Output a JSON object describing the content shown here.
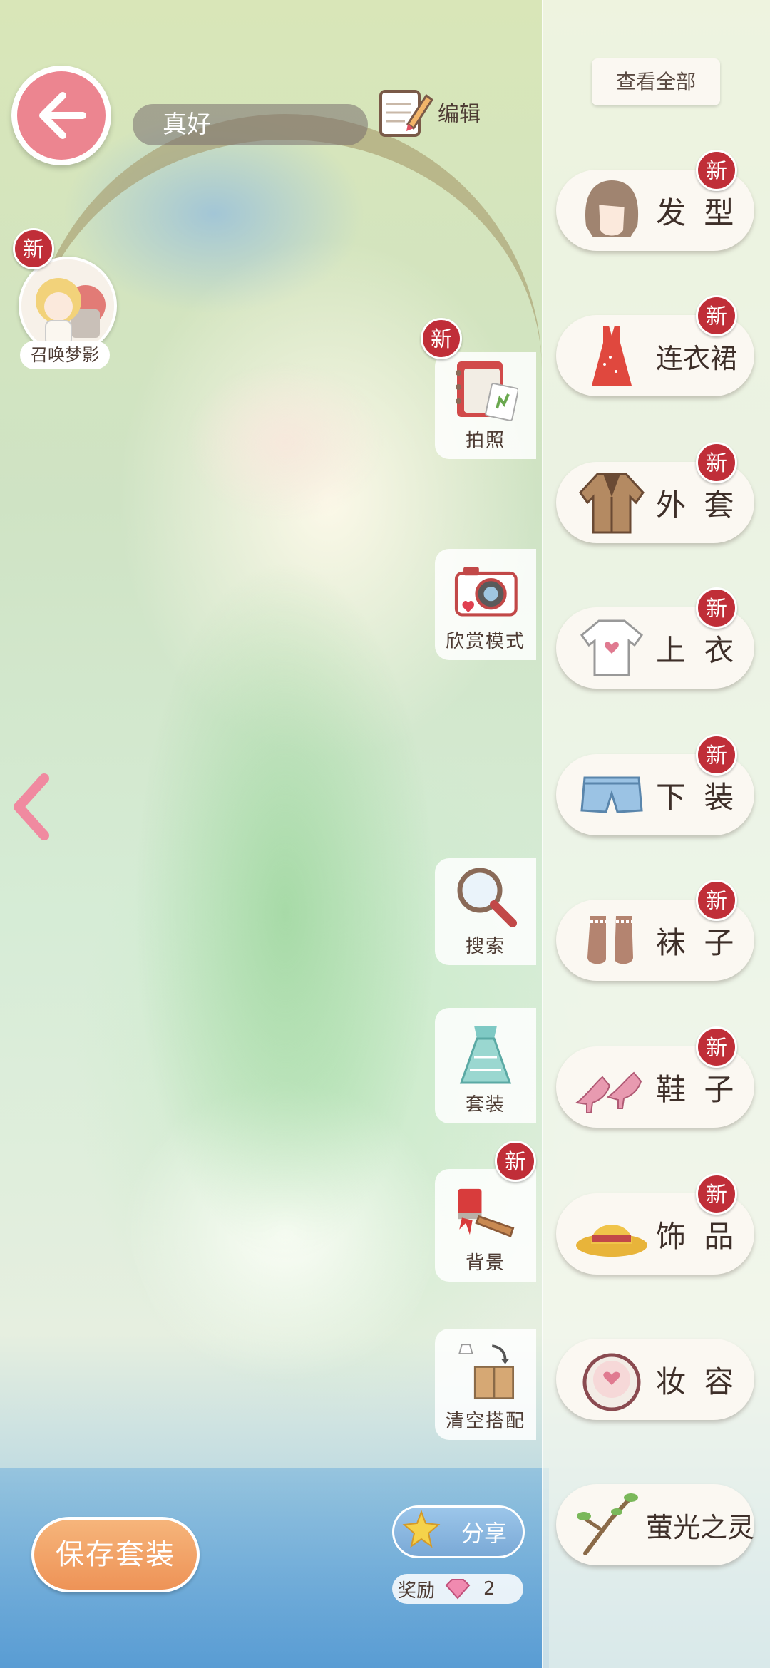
{
  "header": {
    "outfit_name": "真好",
    "edit_label": "编辑",
    "back_icon": "back-arrow-icon"
  },
  "summon": {
    "label": "召唤梦影",
    "new_badge": "新"
  },
  "side_actions": [
    {
      "id": "photo",
      "label": "拍照",
      "icon": "photo-album-icon",
      "new_badge": "新"
    },
    {
      "id": "appreciate",
      "label": "欣赏模式",
      "icon": "camera-icon"
    },
    {
      "id": "search",
      "label": "搜索",
      "icon": "magnifier-icon"
    },
    {
      "id": "suits",
      "label": "套装",
      "icon": "suit-dress-icon"
    },
    {
      "id": "background",
      "label": "背景",
      "icon": "paint-brush-icon",
      "new_badge": "新"
    },
    {
      "id": "clear",
      "label": "清空搭配",
      "icon": "clear-box-icon"
    }
  ],
  "categories_header": {
    "view_all": "查看全部"
  },
  "categories": [
    {
      "label": "发 型",
      "icon": "hair-icon",
      "new_badge": "新"
    },
    {
      "label": "连衣裙",
      "icon": "dress-icon",
      "new_badge": "新"
    },
    {
      "label": "外 套",
      "icon": "coat-icon",
      "new_badge": "新"
    },
    {
      "label": "上 衣",
      "icon": "shirt-icon",
      "new_badge": "新"
    },
    {
      "label": "下 装",
      "icon": "shorts-icon",
      "new_badge": "新"
    },
    {
      "label": "袜 子",
      "icon": "socks-icon",
      "new_badge": "新"
    },
    {
      "label": "鞋 子",
      "icon": "heels-icon",
      "new_badge": "新"
    },
    {
      "label": "饰 品",
      "icon": "hat-icon",
      "new_badge": "新"
    },
    {
      "label": "妆 容",
      "icon": "makeup-compact-icon"
    },
    {
      "label": "萤光之灵",
      "icon": "firefly-branch-icon"
    }
  ],
  "bottom": {
    "save_label": "保存套装",
    "share_label": "分享",
    "reward_label": "奖励",
    "reward_count": "2"
  },
  "colors": {
    "new_badge": "#c02e38",
    "back_button": "#ec8590",
    "save_button": "#ee9357",
    "share_button": "#7aa9d6"
  }
}
